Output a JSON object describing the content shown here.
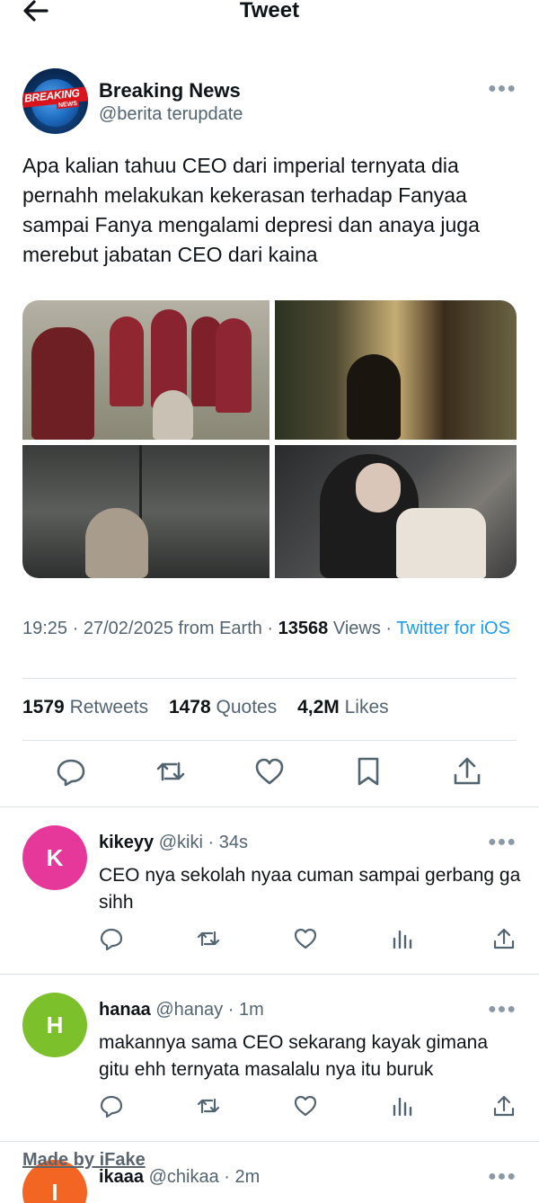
{
  "header": {
    "title": "Tweet"
  },
  "tweet": {
    "author_name": "Breaking News",
    "author_handle": "@berita terupdate",
    "avatar_text": {
      "line1": "BREAKING",
      "line2": "NEWS"
    },
    "text": "Apa kalian tahuu CEO dari imperial ternyata dia pernahh melakukan kekerasan terhadap Fanyaa sampai Fanya mengalami depresi dan anaya juga merebut jabatan CEO dari kaina",
    "time": "19:25",
    "date": "27/02/2025",
    "from": "from Earth",
    "views_count": "13568",
    "views_label": "Views",
    "source": "Twitter for iOS",
    "retweets_count": "1579",
    "retweets_label": "Retweets",
    "quotes_count": "1478",
    "quotes_label": "Quotes",
    "likes_count": "4,2M",
    "likes_label": "Likes"
  },
  "replies": [
    {
      "avatar_letter": "K",
      "avatar_color": "#e6389a",
      "name": "kikeyy",
      "handle": "@kiki",
      "time": "34s",
      "text": "CEO nya sekolah nyaa cuman sampai gerbang ga sihh"
    },
    {
      "avatar_letter": "H",
      "avatar_color": "#7cc02b",
      "name": "hanaa",
      "handle": "@hanay",
      "time": "1m",
      "text": "makannya sama CEO sekarang kayak gimana gitu ehh ternyata masalalu nya itu buruk"
    },
    {
      "avatar_letter": "I",
      "avatar_color": "#f26522",
      "name": "ikaaa",
      "handle": "@chikaa",
      "time": "2m",
      "text": ""
    }
  ],
  "watermark": "Made by iFake",
  "colors": {
    "link": "#1d9bf0",
    "secondary_text": "#536471",
    "divider": "#dde3e7"
  }
}
